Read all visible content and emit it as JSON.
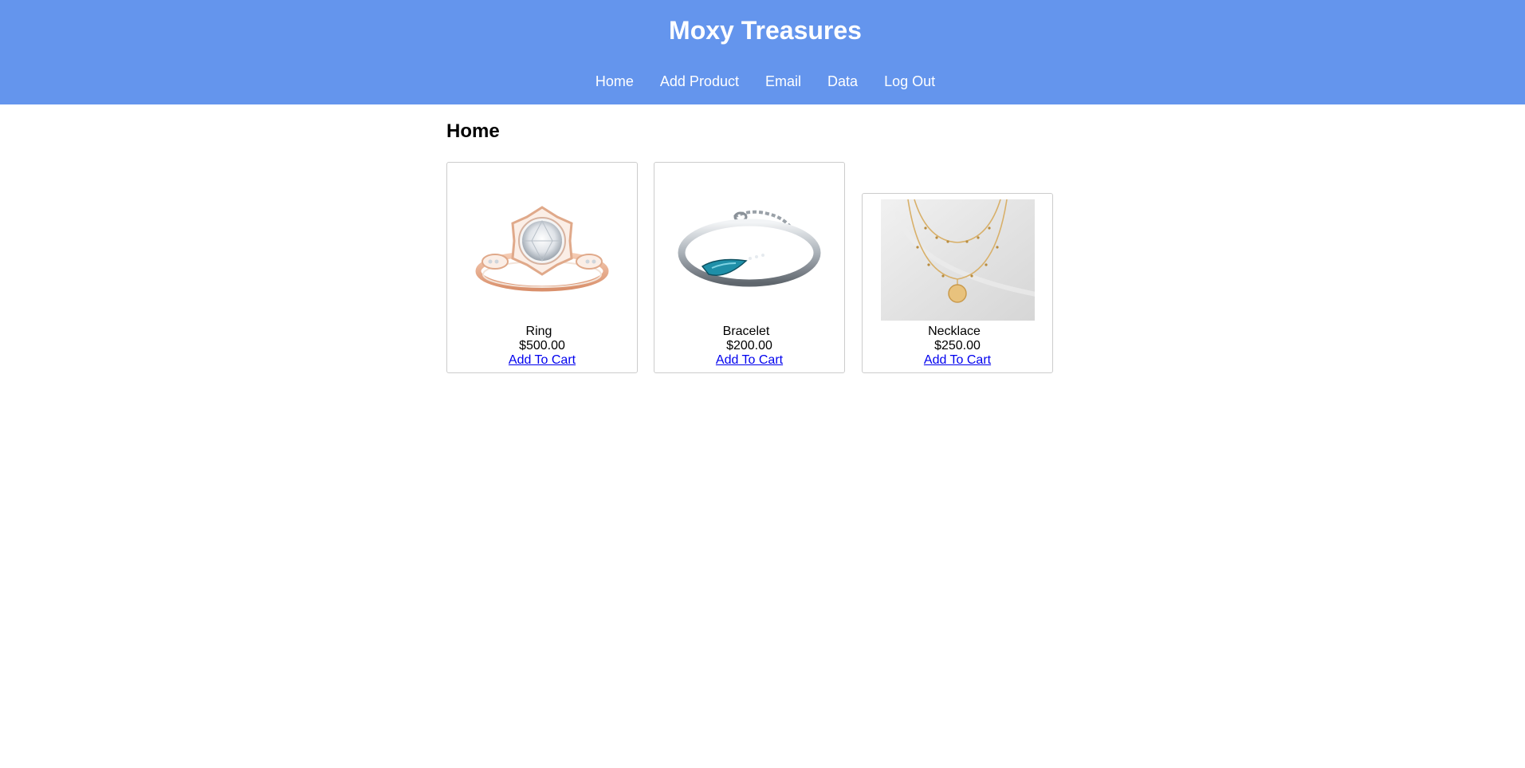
{
  "header": {
    "site_title": "Moxy Treasures",
    "background_color": "#6495ed",
    "nav": [
      {
        "label": "Home"
      },
      {
        "label": "Add Product"
      },
      {
        "label": "Email"
      },
      {
        "label": "Data"
      },
      {
        "label": "Log Out"
      }
    ]
  },
  "main": {
    "heading": "Home",
    "products": [
      {
        "name": "Ring",
        "price": "$500.00",
        "action": "Add To Cart",
        "icon": "ring-image"
      },
      {
        "name": "Bracelet",
        "price": "$200.00",
        "action": "Add To Cart",
        "icon": "bracelet-image"
      },
      {
        "name": "Necklace",
        "price": "$250.00",
        "action": "Add To Cart",
        "icon": "necklace-image"
      }
    ]
  },
  "colors": {
    "link": "#0000ee",
    "card_border": "#cccccc"
  }
}
